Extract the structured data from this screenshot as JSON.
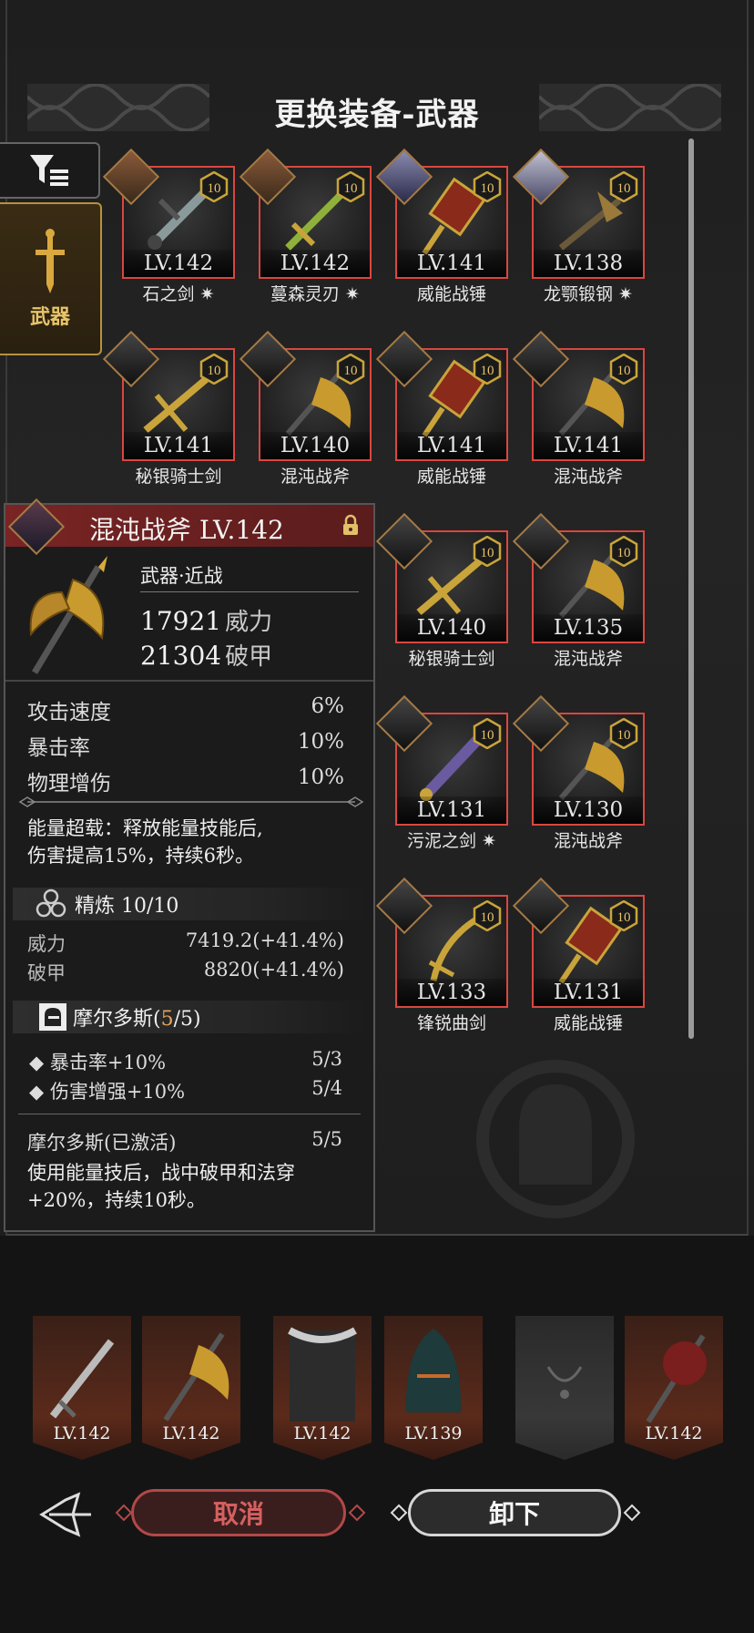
{
  "title": "更换装备-武器",
  "side_tabs": {
    "weapon_label": "武器"
  },
  "items": [
    {
      "lv": "LV.142",
      "name": "石之剑",
      "refine": "10",
      "star": true
    },
    {
      "lv": "LV.142",
      "name": "蔓森灵刃",
      "refine": "10",
      "star": true
    },
    {
      "lv": "LV.141",
      "name": "威能战锤",
      "refine": "10",
      "star": false
    },
    {
      "lv": "LV.138",
      "name": "龙颚锻钢",
      "refine": "10",
      "star": true
    },
    {
      "lv": "LV.141",
      "name": "秘银骑士剑",
      "refine": "10",
      "star": false
    },
    {
      "lv": "LV.140",
      "name": "混沌战斧",
      "refine": "10",
      "star": false
    },
    {
      "lv": "LV.141",
      "name": "威能战锤",
      "refine": "10",
      "star": false
    },
    {
      "lv": "LV.141",
      "name": "混沌战斧",
      "refine": "10",
      "star": false
    },
    {
      "lv": "LV.140",
      "name": "秘银骑士剑",
      "refine": "10",
      "star": false
    },
    {
      "lv": "LV.135",
      "name": "混沌战斧",
      "refine": "10",
      "star": false
    },
    {
      "lv": "LV.131",
      "name": "污泥之剑",
      "refine": "10",
      "star": true
    },
    {
      "lv": "LV.130",
      "name": "混沌战斧",
      "refine": "10",
      "star": false
    },
    {
      "lv": "LV.133",
      "name": "锋锐曲剑",
      "refine": "10",
      "star": false
    },
    {
      "lv": "LV.131",
      "name": "威能战锤",
      "refine": "10",
      "star": false
    }
  ],
  "detail": {
    "title": "混沌战斧 LV.142",
    "type": "武器·近战",
    "stat1_value": "17921",
    "stat1_label": "威力",
    "stat2_value": "21304",
    "stat2_label": "破甲",
    "sub_stats": [
      {
        "label": "攻击速度",
        "value": "6%"
      },
      {
        "label": "暴击率",
        "value": "10%"
      },
      {
        "label": "物理增伤",
        "value": "10%"
      }
    ],
    "effect_line1": "能量超载：释放能量技能后,",
    "effect_line2": "伤害提高15%，持续6秒。",
    "refine_title": "精炼 10/10",
    "refine_rows": [
      {
        "label": "威力",
        "value": "7419.2(+41.4%)"
      },
      {
        "label": "破甲",
        "value": "8820(+41.4%)"
      }
    ],
    "set_name": "摩尔多斯(",
    "set_count": "5",
    "set_total": "/5)",
    "set_bonuses": [
      {
        "label": "暴击率+10%",
        "value": "5/3"
      },
      {
        "label": "伤害增强+10%",
        "value": "5/4"
      }
    ],
    "set_active_label": "摩尔多斯(已激活)",
    "set_active_value": "5/5",
    "set_desc_line1": "使用能量技后，战中破甲和法穿",
    "set_desc_line2": "+20%，持续10秒。"
  },
  "equipped": [
    {
      "lv": "LV.142"
    },
    {
      "lv": "LV.142"
    },
    {
      "lv": "LV.142"
    },
    {
      "lv": "LV.139"
    },
    {
      "lv": ""
    },
    {
      "lv": "LV.142"
    }
  ],
  "buttons": {
    "cancel": "取消",
    "unequip": "卸下"
  },
  "colors": {
    "card_border": "#d9473f",
    "header_red": "#7a2424",
    "accent_gold": "#e8c46a",
    "effect_orange": "#e6a35a"
  }
}
